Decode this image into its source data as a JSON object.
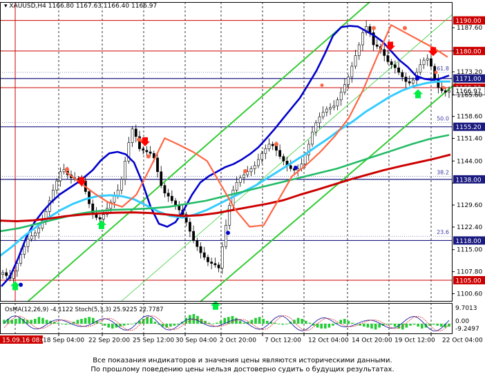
{
  "header": {
    "symbol_label": "XAUUSD,H4",
    "ohlc": "1166.80 1167.63 1166.40 1166.97"
  },
  "disclaimer": {
    "line1": "Все показания индикаторов и значения цены являются историческими данными.",
    "line2": "По прошлому поведению цены нельзя достоверно судить о будущих результатах."
  },
  "colors": {
    "background": "#ffffff",
    "candle_up": "#00aa00",
    "candle_down": "#e00000",
    "channel": "#33cc33",
    "level_red": "#cc0000",
    "level_blue": "#1a1a80",
    "level_label_red": "#cc0000",
    "level_label_blue": "#1a1a80",
    "ema_fast": "#0000cc",
    "ema_mid": "#33ccff",
    "ema_slow": "#22bb66",
    "ema_long": "#cc0000",
    "envelope": "#ff6644",
    "arrow_down": "#ff0000",
    "arrow_up": "#00ee44"
  },
  "chart_data": [
    {
      "type": "candlestick",
      "title": "XAUUSD,H4",
      "ohlc_current": {
        "open": 1166.8,
        "high": 1167.63,
        "low": 1166.4,
        "close": 1166.97
      },
      "ylim": [
        1098.0,
        1196.0
      ],
      "y_ticks": [
        1187.6,
        1180.0,
        1173.2,
        1165.6,
        1158.6,
        1151.4,
        1144.0,
        1136.8,
        1129.6,
        1122.4,
        1115.0,
        1107.8,
        1100.6
      ],
      "x_labels": [
        "15.09.16 08:00",
        "18 Sep 04:00",
        "22 Sep 20:00",
        "25 Sep 12:00",
        "30 Sep 04:00",
        "2 Oct 20:00",
        "7 Oct 12:00",
        "12 Oct 04:00",
        "14 Oct 20:00",
        "19 Oct 12:00",
        "22 Oct 04:00"
      ],
      "horizontal_levels": [
        {
          "value": 1190.0,
          "label": "1190.00",
          "color": "red"
        },
        {
          "value": 1180.0,
          "label": "1180.00",
          "color": "red"
        },
        {
          "value": 1171.0,
          "label": "1171.00",
          "color": "blue"
        },
        {
          "value": 1168.0,
          "label": "1168.00",
          "color": "red"
        },
        {
          "value": 1155.2,
          "label": "1155.20",
          "color": "blue"
        },
        {
          "value": 1138.0,
          "label": "1138.00",
          "color": "blue"
        },
        {
          "value": 1118.0,
          "label": "1118.00",
          "color": "blue"
        },
        {
          "value": 1105.0,
          "label": "1105.00",
          "color": "red"
        }
      ],
      "fibonacci": [
        {
          "label": "61.8",
          "value": 1173.0
        },
        {
          "label": "50.0",
          "value": 1156.6
        },
        {
          "label": "38.2",
          "value": 1139.0
        },
        {
          "label": "23.6",
          "value": 1119.4
        }
      ],
      "close_series": [
        1107.5,
        1106.5,
        1105.6,
        1108.0,
        1110.5,
        1113.5,
        1116.0,
        1118.5,
        1119.5,
        1120.5,
        1122.0,
        1124.5,
        1127.5,
        1131.0,
        1134.5,
        1137.5,
        1140.5,
        1141.2,
        1139.5,
        1138.5,
        1138.2,
        1138.0,
        1137.5,
        1134.0,
        1130.0,
        1127.0,
        1125.5,
        1125.0,
        1126.5,
        1128.5,
        1130.5,
        1132.5,
        1134.5,
        1138.0,
        1144.0,
        1150.0,
        1154.5,
        1152.0,
        1148.0,
        1147.5,
        1147.0,
        1146.5,
        1145.0,
        1140.5,
        1136.0,
        1133.5,
        1132.5,
        1131.0,
        1129.5,
        1128.0,
        1126.5,
        1124.0,
        1121.0,
        1118.0,
        1116.0,
        1114.0,
        1112.5,
        1111.0,
        1110.5,
        1110.0,
        1109.0,
        1116.0,
        1123.0,
        1129.5,
        1134.5,
        1137.0,
        1138.5,
        1139.5,
        1140.5,
        1141.5,
        1142.5,
        1144.5,
        1146.5,
        1148.0,
        1149.5,
        1149.0,
        1147.5,
        1145.5,
        1144.0,
        1142.5,
        1141.5,
        1141.0,
        1141.5,
        1143.0,
        1146.0,
        1149.5,
        1153.5,
        1156.5,
        1158.5,
        1160.0,
        1161.0,
        1161.5,
        1162.0,
        1164.0,
        1166.5,
        1169.0,
        1171.5,
        1175.0,
        1178.5,
        1182.0,
        1186.0,
        1188.0,
        1186.0,
        1182.0,
        1181.5,
        1180.5,
        1178.5,
        1176.5,
        1175.5,
        1174.5,
        1173.0,
        1171.5,
        1170.0,
        1169.5,
        1170.5,
        1173.0,
        1175.5,
        1177.0,
        1177.5,
        1175.0,
        1171.0,
        1168.0,
        1167.0,
        1166.5,
        1167.0
      ],
      "series": [
        {
          "name": "EMA fast",
          "color": "#0000cc",
          "values": [
            1103.0,
            1106.0,
            1112.0,
            1119.0,
            1124.0,
            1127.5,
            1130.5,
            1133.0,
            1134.8,
            1136.6,
            1138.7,
            1141.0,
            1144.2,
            1146.5,
            1147.0,
            1146.2,
            1143.5,
            1137.0,
            1129.0,
            1123.5,
            1122.5,
            1124.0,
            1128.0,
            1133.0,
            1137.0,
            1139.0,
            1140.5,
            1142.0,
            1143.0,
            1144.5,
            1146.3,
            1148.5,
            1151.5,
            1154.6,
            1158.0,
            1161.3,
            1164.6,
            1169.0,
            1173.5,
            1179.0,
            1185.0,
            1187.8,
            1188.2,
            1188.0,
            1186.5,
            1185.0,
            1183.0,
            1180.0,
            1177.0,
            1174.8,
            1171.9,
            1170.9,
            1170.5,
            1171.0,
            1172.0
          ]
        },
        {
          "name": "EMA mid",
          "color": "#33ccff",
          "values": [
            1113.0,
            1116.0,
            1119.5,
            1122.5,
            1125.5,
            1128.0,
            1130.0,
            1131.5,
            1132.5,
            1132.8,
            1132.5,
            1131.5,
            1129.5,
            1127.5,
            1126.0,
            1125.5,
            1126.5,
            1128.0,
            1130.0,
            1132.0,
            1134.0,
            1136.0,
            1138.5,
            1141.0,
            1143.5,
            1146.0,
            1148.8,
            1151.5,
            1154.5,
            1157.0,
            1160.0,
            1162.5,
            1165.0,
            1167.0,
            1168.5,
            1169.5,
            1170.0,
            1170.0
          ]
        },
        {
          "name": "EMA slow",
          "color": "#22bb66",
          "values": [
            1121.0,
            1122.0,
            1123.5,
            1125.0,
            1126.5,
            1127.5,
            1128.0,
            1128.2,
            1128.5,
            1129.0,
            1130.0,
            1131.0,
            1132.5,
            1134.0,
            1135.5,
            1137.0,
            1138.5,
            1140.0,
            1141.5,
            1143.5,
            1145.5,
            1147.5,
            1149.5,
            1151.3,
            1152.5
          ]
        },
        {
          "name": "EMA long",
          "color": "#cc0000",
          "values": [
            1124.5,
            1124.3,
            1124.6,
            1125.2,
            1126.0,
            1126.5,
            1126.9,
            1127.1,
            1127.2,
            1127.0,
            1126.5,
            1126.0,
            1126.3,
            1127.0,
            1128.0,
            1129.0,
            1130.0,
            1131.2,
            1133.0,
            1134.6,
            1136.3,
            1138.0,
            1139.5,
            1141.0,
            1142.3,
            1143.5,
            1144.7,
            1146.1
          ]
        },
        {
          "name": "Envelope",
          "color": "#ff6644",
          "values": [
            1140.5,
            1137.0,
            1133.5,
            1130.5,
            1129.0,
            1133.0,
            1142.0,
            1151.5,
            1149.3,
            1147.0,
            1144.0,
            1136.0,
            1128.0,
            1122.5,
            1123.0,
            1131.0,
            1139.0,
            1142.7,
            1147.0,
            1152.0,
            1158.0,
            1167.0,
            1178.0,
            1188.5,
            1186.0,
            1183.5,
            1181.0,
            1178.0
          ]
        }
      ],
      "channel_lines": 3,
      "signal_arrows": {
        "down": 3,
        "up": 4
      }
    },
    {
      "type": "oscillator",
      "title": "OsMA + Stochastic",
      "legend": "OsMA(12,26,9) -4.1122  Stoch(5,3,3) 25.9225 22.7787",
      "y_ticks": [
        "9.7013",
        "0.00",
        "-9.2497"
      ],
      "osma": [
        0.4,
        0.5,
        0.4,
        0.5,
        0.6,
        0.5,
        0.4,
        0.4,
        0.5,
        0.7,
        0.6,
        0.4,
        0.3,
        0.2,
        0.1,
        0.0,
        -0.1,
        0.0,
        0.2,
        0.4,
        0.5,
        0.6,
        0.7,
        0.6,
        0.3,
        0.1,
        -0.2,
        -0.4,
        -0.5,
        -0.4,
        -0.3,
        -0.2,
        -0.1,
        0.0,
        0.1,
        0.3,
        0.5,
        0.7,
        0.6,
        0.2,
        -0.1,
        -0.3,
        -0.4,
        -0.3,
        -0.2,
        -0.1,
        0.2,
        0.6,
        0.9,
        1.0,
        0.8,
        0.5,
        0.3,
        0.1,
        0.0,
        0.1,
        0.3,
        0.6,
        0.7,
        0.8,
        0.6,
        0.3,
        0.1,
        0.2,
        0.4,
        0.6,
        0.7,
        0.5,
        0.3,
        0.2,
        0.1,
        0.0,
        -0.1,
        0.0,
        0.2,
        0.4,
        0.6,
        0.5,
        0.3,
        0.1,
        -0.2,
        -0.4,
        -0.5,
        -0.5,
        -0.4,
        -0.2,
        0.1,
        0.4,
        0.5,
        0.3,
        0.1,
        -0.1,
        -0.2,
        -0.3,
        -0.4,
        -0.5,
        -0.6,
        -0.4,
        -0.2,
        0.0,
        -0.1,
        -0.3,
        -0.5,
        -0.6,
        -0.4,
        -0.2,
        -0.1,
        -0.3,
        -0.5,
        -0.4,
        -0.2,
        -0.1,
        -0.2,
        -0.3,
        -0.4,
        -0.3
      ]
    }
  ]
}
